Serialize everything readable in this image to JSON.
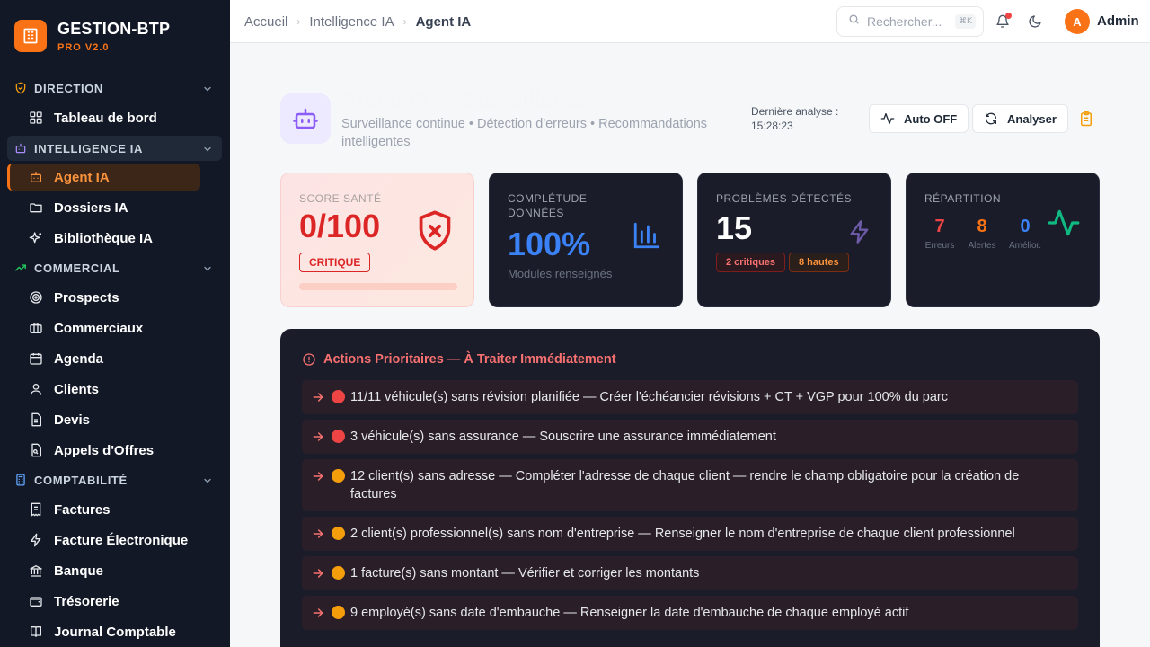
{
  "brand": {
    "name": "GESTION-BTP",
    "version": "PRO V2.0"
  },
  "sidebar": {
    "sections": [
      {
        "label": "DIRECTION",
        "icon": "shield-check-icon",
        "items": [
          {
            "label": "Tableau de bord",
            "icon": "dashboard-icon"
          }
        ]
      },
      {
        "label": "INTELLIGENCE IA",
        "icon": "robot-icon",
        "items": [
          {
            "label": "Agent IA",
            "icon": "robot-icon"
          },
          {
            "label": "Dossiers IA",
            "icon": "folder-icon"
          },
          {
            "label": "Bibliothèque IA",
            "icon": "sparkles-icon"
          }
        ]
      },
      {
        "label": "COMMERCIAL",
        "icon": "trending-up-icon",
        "items": [
          {
            "label": "Prospects",
            "icon": "target-icon"
          },
          {
            "label": "Commerciaux",
            "icon": "briefcase-icon"
          },
          {
            "label": "Agenda",
            "icon": "calendar-icon"
          },
          {
            "label": "Clients",
            "icon": "users-icon"
          },
          {
            "label": "Devis",
            "icon": "document-icon"
          },
          {
            "label": "Appels d'Offres",
            "icon": "file-search-icon"
          }
        ]
      },
      {
        "label": "COMPTABILITÉ",
        "icon": "calculator-icon",
        "items": [
          {
            "label": "Factures",
            "icon": "receipt-icon"
          },
          {
            "label": "Facture Électronique",
            "icon": "lightning-icon"
          },
          {
            "label": "Banque",
            "icon": "bank-icon"
          },
          {
            "label": "Trésorerie",
            "icon": "wallet-icon"
          },
          {
            "label": "Journal Comptable",
            "icon": "book-icon"
          }
        ]
      }
    ]
  },
  "header": {
    "breadcrumb": [
      "Accueil",
      "Intelligence IA",
      "Agent IA"
    ],
    "search_placeholder": "Rechercher...",
    "shortcut": "⌘K",
    "user": {
      "initial": "A",
      "name": "Admin"
    }
  },
  "page": {
    "title": "Agent IA — Surveillance",
    "subtitle": "Surveillance continue • Détection d'erreurs • Recommandations intelligentes",
    "last_analysis_label": "Dernière analyse :",
    "last_analysis_time": "15:28:23",
    "auto_button": "Auto OFF",
    "analyze_button": "Analyser"
  },
  "cards": {
    "health": {
      "label": "SCORE SANTÉ",
      "value": "0/100",
      "badge": "CRITIQUE",
      "score_fraction": 0.0
    },
    "completeness": {
      "label": "COMPLÉTUDE DONNÉES",
      "value": "100%",
      "note": "Modules renseignés"
    },
    "problems": {
      "label": "PROBLÈMES DÉTECTÉS",
      "value": "15",
      "critical": "2 critiques",
      "high": "8 hautes"
    },
    "distribution": {
      "label": "RÉPARTITION",
      "errors_value": "7",
      "errors_label": "Erreurs",
      "alerts_value": "8",
      "alerts_label": "Alertes",
      "improvements_value": "0",
      "improvements_label": "Amélior."
    }
  },
  "actions": {
    "title": "Actions Prioritaires — À Traiter Immédiatement",
    "items": [
      {
        "severity": "red",
        "text": "11/11 véhicule(s) sans révision planifiée — Créer l'échéancier révisions + CT + VGP pour 100% du parc"
      },
      {
        "severity": "red",
        "text": "3 véhicule(s) sans assurance — Souscrire une assurance immédiatement"
      },
      {
        "severity": "orange",
        "text": "12 client(s) sans adresse — Compléter l'adresse de chaque client — rendre le champ obligatoire pour la création de factures"
      },
      {
        "severity": "orange",
        "text": "2 client(s) professionnel(s) sans nom d'entreprise — Renseigner le nom d'entreprise de chaque client professionnel"
      },
      {
        "severity": "orange",
        "text": "1 facture(s) sans montant — Vérifier et corriger les montants"
      },
      {
        "severity": "orange",
        "text": "9 employé(s) sans date d'embauche — Renseigner la date d'embauche de chaque employé actif"
      }
    ]
  },
  "colors": {
    "accent": "#f97316",
    "danger": "#dc2626",
    "info": "#3b82f6",
    "sidebar_bg": "#121826",
    "panel_bg": "#1a1c29"
  }
}
